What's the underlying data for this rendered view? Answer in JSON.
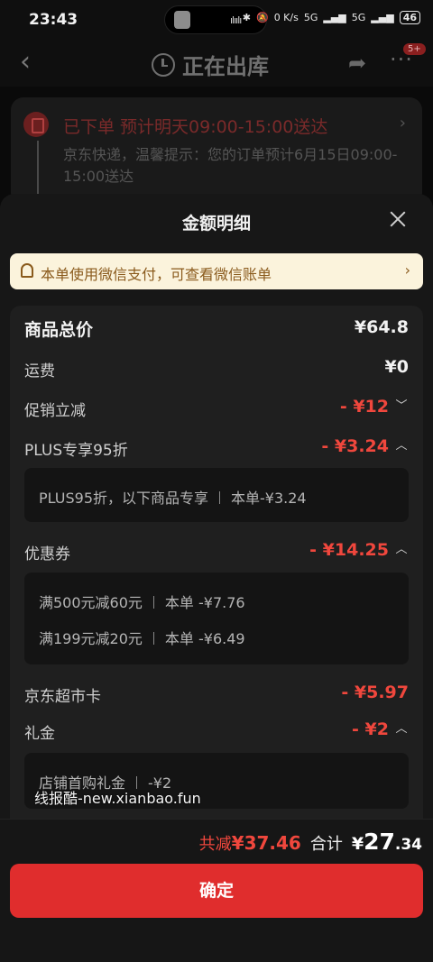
{
  "status_bar": {
    "time": "23:43",
    "network_speed": "0 K/s",
    "signal_1": "5G",
    "signal_2": "5G",
    "battery": "46"
  },
  "header": {
    "title": "正在出库",
    "badge": "5+"
  },
  "order_card": {
    "status": "已下单",
    "eta": "预计明天09:00-15:00送达",
    "description": "京东快递，温馨提示：您的订单预计6月15日09:00-15:00送达"
  },
  "sheet": {
    "title": "金额明细",
    "notice": "本单使用微信支付，可查看微信账单",
    "rows": {
      "goods_total": {
        "label": "商品总价",
        "value": "¥64.8"
      },
      "shipping": {
        "label": "运费",
        "value": "¥0"
      },
      "promo": {
        "label": "促销立减",
        "value": "- ¥12"
      },
      "plus": {
        "label": "PLUS专享95折",
        "value": "- ¥3.24"
      },
      "coupon": {
        "label": "优惠券",
        "value": "- ¥14.25"
      },
      "market_card": {
        "label": "京东超市卡",
        "value": "- ¥5.97"
      },
      "gift": {
        "label": "礼金",
        "value": "- ¥2"
      }
    },
    "plus_detail": {
      "name": "PLUS95折，以下商品专享",
      "amount": "本单-¥3.24"
    },
    "coupon_details": [
      {
        "name": "满500元减60元",
        "amount": "本单 -¥7.76"
      },
      {
        "name": "满199元减20元",
        "amount": "本单 -¥6.49"
      }
    ],
    "gift_detail": {
      "name": "店铺首购礼金",
      "amount": "-¥2"
    }
  },
  "watermark": "线报酷-new.xianbao.fun",
  "footer": {
    "saved_label": "共减",
    "saved_value": "¥37.46",
    "total_label": "合计",
    "total_currency": "¥",
    "total_int": "27",
    "total_dec": ".34",
    "confirm": "确定"
  },
  "colors": {
    "accent_red": "#f0473d",
    "button_red": "#e02d2d",
    "notice_bg": "#fbf3dc"
  }
}
